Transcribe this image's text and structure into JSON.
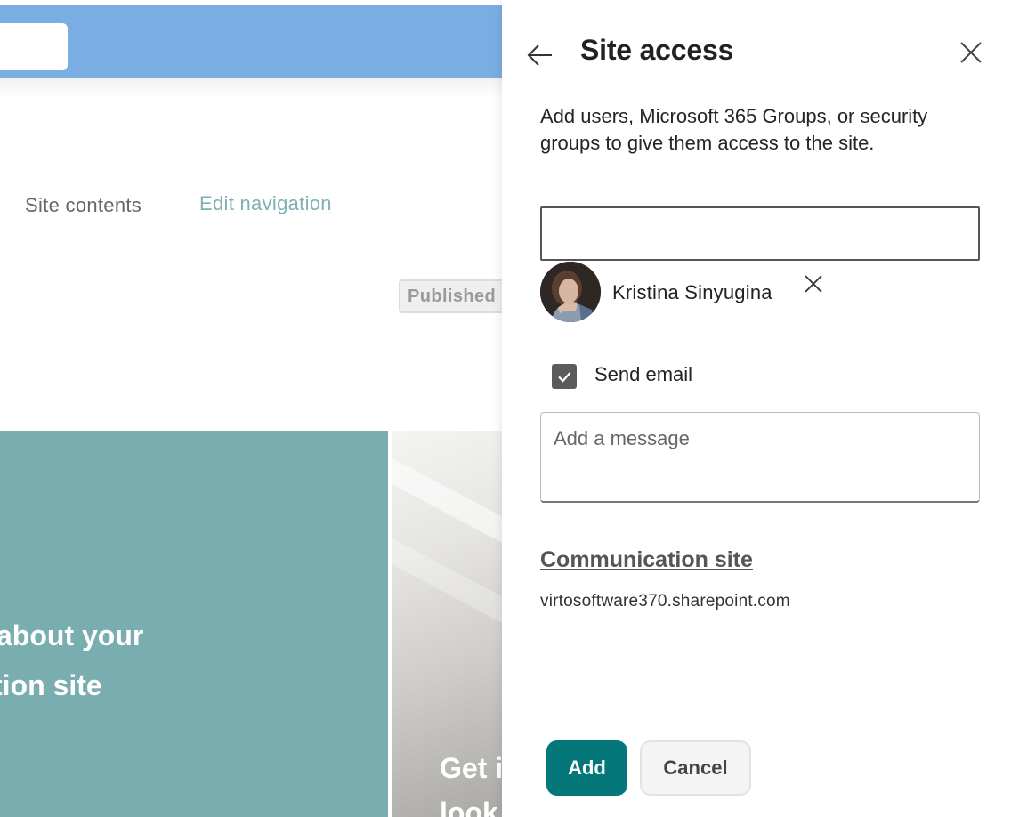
{
  "background": {
    "nav": {
      "site_contents": "Site contents",
      "edit_navigation": "Edit navigation"
    },
    "status_badge": "Published",
    "hero": {
      "line1": "about your",
      "line2": "tion site",
      "right_text": "Get i",
      "right_text_2": "look"
    },
    "colors": {
      "topbar": "#7aaee3",
      "hero_teal": "#7aadb0"
    }
  },
  "panel": {
    "title": "Site access",
    "back_icon": "arrow-left-icon",
    "close_icon": "close-icon",
    "description": "Add users, Microsoft 365 Groups, or security groups to give them access to the site.",
    "people_input_value": "",
    "selected_people": [
      {
        "name": "Kristina Sinyugina",
        "remove_icon": "close-icon"
      }
    ],
    "send_email": {
      "label": "Send email",
      "checked": true
    },
    "message_placeholder": "Add a message",
    "site": {
      "name": "Communication site",
      "url": "virtosoftware370.sharepoint.com"
    },
    "buttons": {
      "add": "Add",
      "cancel": "Cancel"
    },
    "colors": {
      "accent": "#04777a"
    }
  }
}
